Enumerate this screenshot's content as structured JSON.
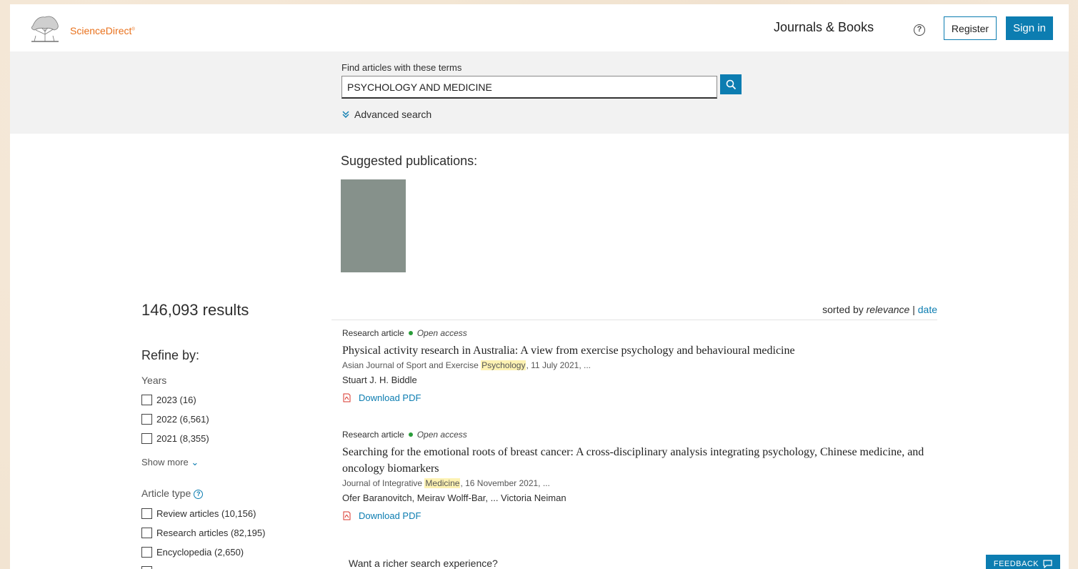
{
  "header": {
    "brand": "ScienceDirect",
    "brand_mark": "®",
    "journals_books": "Journals & Books",
    "help": "?",
    "register": "Register",
    "signin": "Sign in"
  },
  "search": {
    "label": "Find articles with these terms",
    "value": "PSYCHOLOGY AND MEDICINE",
    "advanced": "Advanced search"
  },
  "suggested": {
    "title": "Suggested publications:"
  },
  "results": {
    "count": "146,093 results",
    "sort_prefix": "sorted by",
    "sort_relevance": "relevance",
    "sort_sep": "|",
    "sort_date": "date"
  },
  "sidebar": {
    "refine_title": "Refine by:",
    "years_label": "Years",
    "years": [
      {
        "label": "2023 (16)"
      },
      {
        "label": "2022 (6,561)"
      },
      {
        "label": "2021 (8,355)"
      }
    ],
    "show_more": "Show more",
    "article_type_label": "Article type",
    "article_types": [
      {
        "label": "Review articles (10,156)"
      },
      {
        "label": "Research articles (82,195)"
      },
      {
        "label": "Encyclopedia (2,650)"
      }
    ]
  },
  "articles": [
    {
      "type": "Research article",
      "access": "Open access",
      "title": "Physical activity research in Australia: A view from exercise psychology and behavioural medicine",
      "source_before": "Asian Journal of Sport and Exercise ",
      "source_highlight": "Psychology",
      "source_after": ", 11 July 2021, ...",
      "authors": "Stuart J. H. Biddle",
      "pdf": "Download PDF"
    },
    {
      "type": "Research article",
      "access": "Open access",
      "title": "Searching for the emotional roots of breast cancer: A cross-disciplinary analysis integrating psychology, Chinese medicine, and oncology biomarkers",
      "source_before": "Journal of Integrative ",
      "source_highlight": "Medicine",
      "source_after": ", 16 November 2021, ...",
      "authors": "Ofer Baranovitch, Meirav Wolff-Bar, ... Victoria Neiman",
      "pdf": "Download PDF"
    }
  ],
  "richer": "Want a richer search experience?",
  "feedback": "FEEDBACK",
  "colors": {
    "accent": "#0c7db1",
    "brand": "#e9711c",
    "open_access_dot": "#2a9d3a",
    "highlight": "#fdf2b3"
  },
  "icons": [
    "elsevier-tree-logo",
    "help-icon",
    "search-icon",
    "chevron-down-icon",
    "info-icon",
    "pdf-icon",
    "feedback-icon"
  ]
}
